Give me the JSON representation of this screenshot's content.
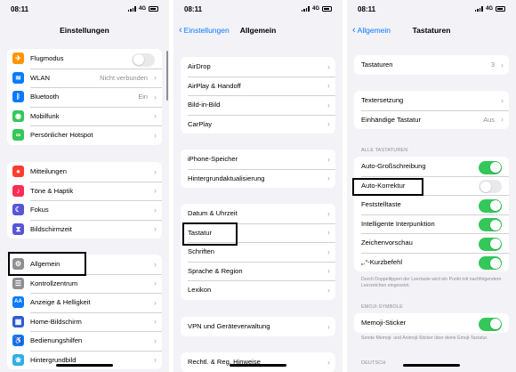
{
  "status": {
    "time": "08:11",
    "network": "4G"
  },
  "settings": {
    "title": "Einstellungen",
    "group1": [
      {
        "label": "Flugmodus",
        "icon": "airplane-icon",
        "glyph": "✈",
        "color": "#ff9500",
        "toggle": false
      },
      {
        "label": "WLAN",
        "icon": "wifi-icon",
        "glyph": "≋",
        "color": "#0a7aff",
        "value": "Nicht verbunden"
      },
      {
        "label": "Bluetooth",
        "icon": "bluetooth-icon",
        "glyph": "ᛒ",
        "color": "#0a7aff",
        "value": "Ein"
      },
      {
        "label": "Mobilfunk",
        "icon": "cellular-icon",
        "glyph": "◉",
        "color": "#34c759"
      },
      {
        "label": "Persönlicher Hotspot",
        "icon": "hotspot-icon",
        "glyph": "∞",
        "color": "#34c759"
      }
    ],
    "group2": [
      {
        "label": "Mitteilungen",
        "icon": "notifications-icon",
        "glyph": "●",
        "color": "#ff3b30"
      },
      {
        "label": "Töne & Haptik",
        "icon": "sounds-icon",
        "glyph": "♪",
        "color": "#ff2d55"
      },
      {
        "label": "Fokus",
        "icon": "focus-icon",
        "glyph": "☾",
        "color": "#5856d6"
      },
      {
        "label": "Bildschirmzeit",
        "icon": "screen-time-icon",
        "glyph": "⧗",
        "color": "#5856d6"
      }
    ],
    "group3": [
      {
        "label": "Allgemein",
        "icon": "gear-icon",
        "glyph": "⚙",
        "color": "#8e8e93"
      },
      {
        "label": "Kontrollzentrum",
        "icon": "control-center-icon",
        "glyph": "☰",
        "color": "#8e8e93"
      },
      {
        "label": "Anzeige & Helligkeit",
        "icon": "display-icon",
        "glyph": "AA",
        "color": "#0a7aff"
      },
      {
        "label": "Home-Bildschirm",
        "icon": "home-screen-icon",
        "glyph": "▦",
        "color": "#2f5bd3"
      },
      {
        "label": "Bedienungshilfen",
        "icon": "accessibility-icon",
        "glyph": "♿",
        "color": "#0a7aff"
      },
      {
        "label": "Hintergrundbild",
        "icon": "wallpaper-icon",
        "glyph": "❀",
        "color": "#32ade6"
      }
    ]
  },
  "general": {
    "title": "Allgemein",
    "back": "Einstellungen",
    "group1": [
      "AirDrop",
      "AirPlay & Handoff",
      "Bild-in-Bild",
      "CarPlay"
    ],
    "group2": [
      "iPhone-Speicher",
      "Hintergrundaktualisierung"
    ],
    "group3": [
      "Datum & Uhrzeit",
      "Tastatur",
      "Schriften",
      "Sprache & Region",
      "Lexikon"
    ],
    "group4": [
      "VPN und Geräteverwaltung"
    ],
    "group5": [
      "Rechtl. & Reg. Hinweise"
    ]
  },
  "keyboards": {
    "title": "Tastaturen",
    "back": "Allgemein",
    "keyboards_row": {
      "label": "Tastaturen",
      "value": "3"
    },
    "text_replacement": "Textersetzung",
    "one_handed": {
      "label": "Einhändige Tastatur",
      "value": "Aus"
    },
    "all_keyboards_header": "ALLE TASTATUREN",
    "toggles": [
      {
        "label": "Auto-Großschreibung",
        "on": true
      },
      {
        "label": "Auto-Korrektur",
        "on": false
      },
      {
        "label": "Feststelltaste",
        "on": true
      },
      {
        "label": "Intelligente Interpunktion",
        "on": true
      },
      {
        "label": "Zeichenvorschau",
        "on": true
      },
      {
        "label": "„.“-Kurzbefehl",
        "on": true
      }
    ],
    "period_footnote": "Durch Doppeltippen der Leertaste wird ein Punkt mit nachfolgendem Leerzeichen eingesetzt.",
    "emoji_header": "EMOJI-SYMBOLE",
    "memoji": {
      "label": "Memoji-Sticker",
      "on": true
    },
    "memoji_footnote": "Sende Memoji- und Animoji-Sticker über deine Emoji-Tastatur.",
    "german_header": "DEUTSCH"
  }
}
